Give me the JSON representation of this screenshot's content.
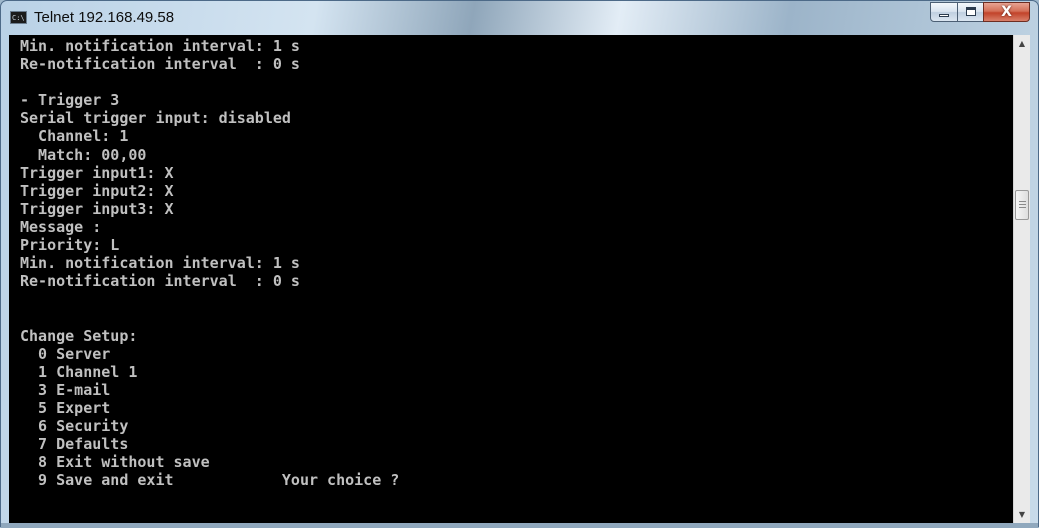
{
  "window": {
    "title": "Telnet 192.168.49.58",
    "icon_text": "C:\\."
  },
  "controls": {
    "minimize_icon": "minimize-icon",
    "maximize_icon": "maximize-icon",
    "close_icon": "close-icon",
    "close_label": "X"
  },
  "console": {
    "lines": [
      "Min. notification interval: 1 s",
      "Re-notification interval  : 0 s",
      "",
      "- Trigger 3",
      "Serial trigger input: disabled",
      "  Channel: 1",
      "  Match: 00,00",
      "Trigger input1: X",
      "Trigger input2: X",
      "Trigger input3: X",
      "Message :",
      "Priority: L",
      "Min. notification interval: 1 s",
      "Re-notification interval  : 0 s",
      "",
      "",
      "Change Setup:",
      "  0 Server",
      "  1 Channel 1",
      "  3 E-mail",
      "  5 Expert",
      "  6 Security",
      "  7 Defaults",
      "  8 Exit without save",
      "  9 Save and exit            Your choice ?"
    ],
    "text_color": "#c0c0c0",
    "background_color": "#000000"
  },
  "scrollbar": {
    "up_arrow": "▲",
    "down_arrow": "▼"
  }
}
